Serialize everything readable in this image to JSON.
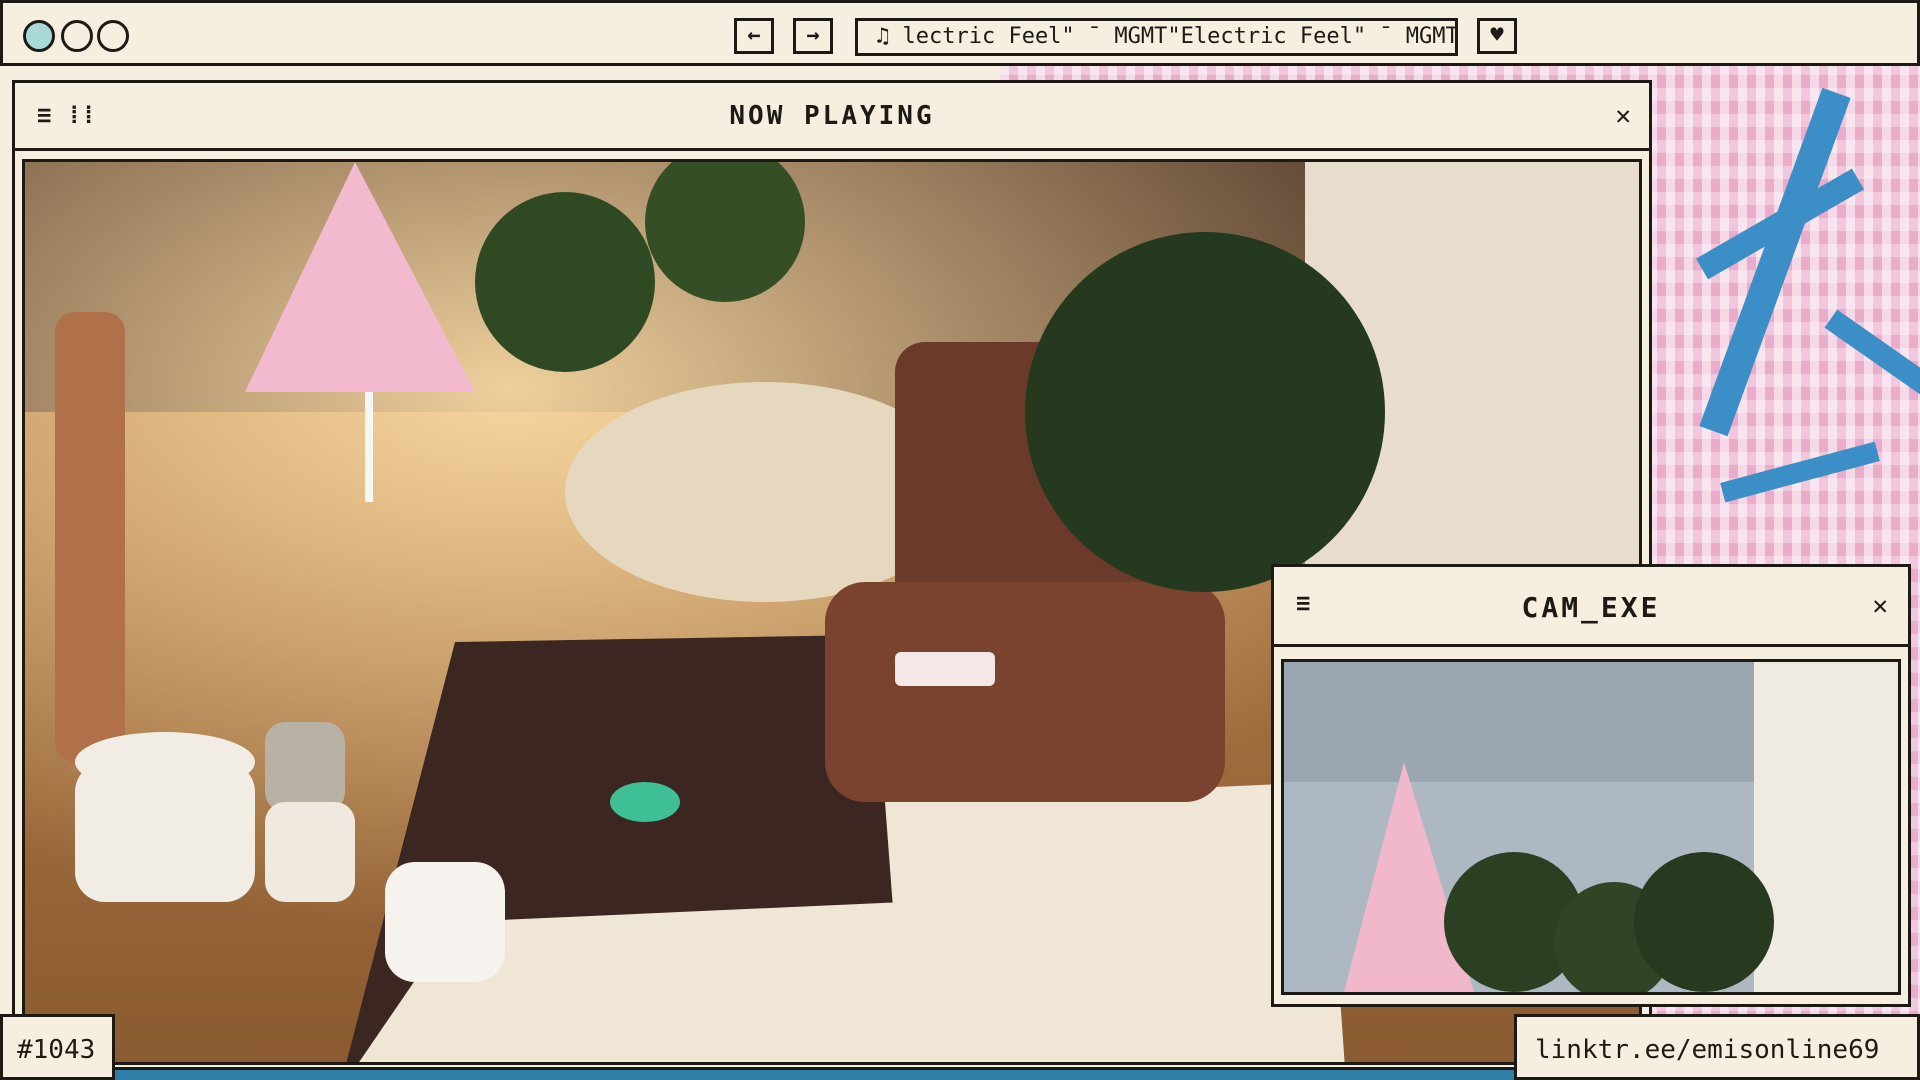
{
  "topbar": {
    "marquee_text": "♫ lectric Feel\"  ¯ MGMT\"Electric Feel\"  ¯ MGMT",
    "back_icon": "arrow-left-icon",
    "forward_icon": "arrow-right-icon",
    "heart_icon": "heart-icon"
  },
  "now_playing": {
    "title": "NOW PLAYING",
    "close": "✕"
  },
  "cam": {
    "title": "CAM_EXE",
    "close": "✕"
  },
  "labels": {
    "episode": "#1043",
    "link": "linktr.ee/emisonline69"
  },
  "colors": {
    "background": "#f6efdf",
    "border": "#1d1a16",
    "sakura_pink": "#f2c6dc",
    "branch_blue": "#3b8fc6",
    "teal_dot": "#a9d8d8"
  }
}
